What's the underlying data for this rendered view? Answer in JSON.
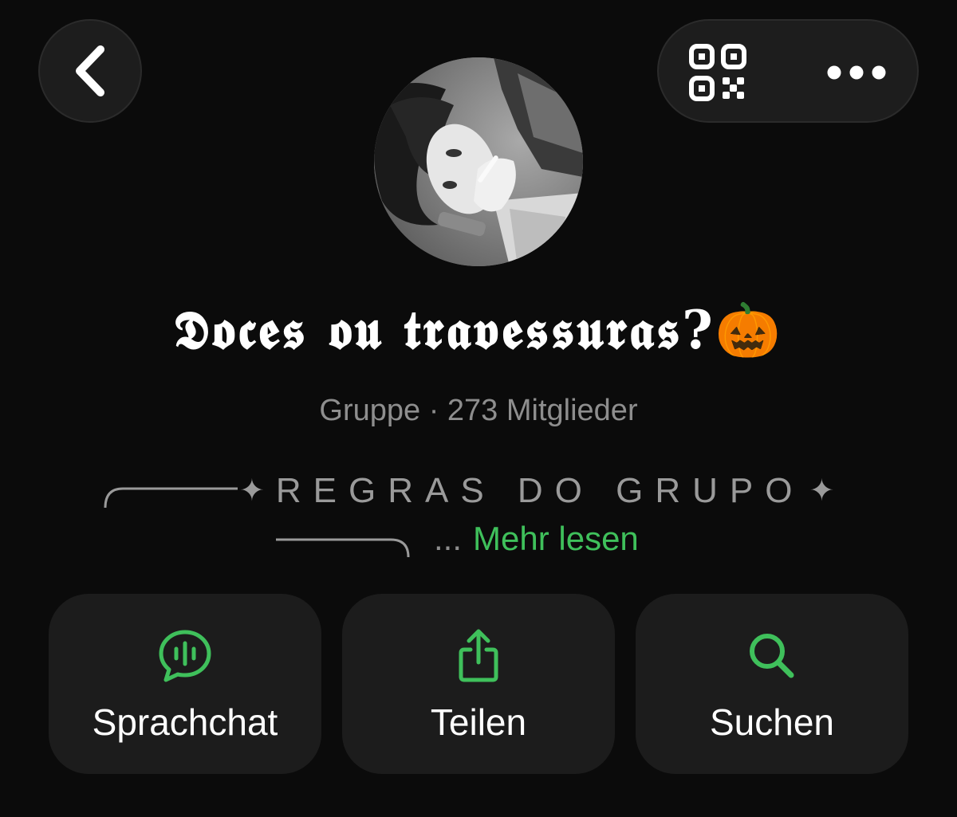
{
  "header": {
    "back_icon": "chevron-left-icon",
    "qr_icon": "qr-code-icon",
    "more_icon": "ellipsis-icon"
  },
  "profile": {
    "avatar": "group-avatar-photo",
    "title": "𝕯𝖔𝖈𝖊𝖘 𝖔𝖚 𝖙𝖗𝖆𝖛𝖊𝖘𝖘𝖚𝖗𝖆𝖘?",
    "title_emoji": "🎃",
    "subtitle": "Gruppe · 273 Mitglieder"
  },
  "description": {
    "rules_text": "REGRAS DO GRUPO",
    "ellipsis": "...",
    "read_more": "Mehr lesen"
  },
  "actions": [
    {
      "label": "Sprachchat",
      "icon": "voice-chat-icon"
    },
    {
      "label": "Teilen",
      "icon": "share-icon"
    },
    {
      "label": "Suchen",
      "icon": "search-icon"
    }
  ],
  "colors": {
    "background": "#0b0b0b",
    "card": "#1c1c1c",
    "accent": "#3fc05b",
    "muted_text": "#8e8e8e"
  }
}
